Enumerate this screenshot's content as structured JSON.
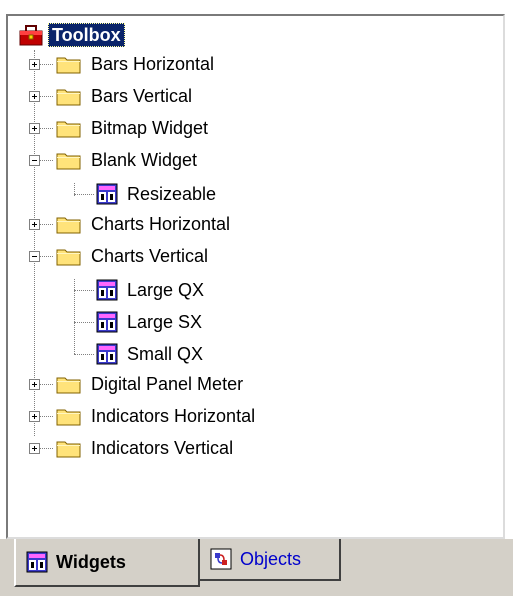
{
  "tree": {
    "root": {
      "label": "Toolbox",
      "icon": "toolbox-icon"
    },
    "items": [
      {
        "label": "Bars Horizontal",
        "type": "folder",
        "expanded": false
      },
      {
        "label": "Bars Vertical",
        "type": "folder",
        "expanded": false
      },
      {
        "label": "Bitmap Widget",
        "type": "folder",
        "expanded": false
      },
      {
        "label": "Blank Widget",
        "type": "folder",
        "expanded": true
      },
      {
        "label": "Resizeable",
        "type": "widget"
      },
      {
        "label": "Charts Horizontal",
        "type": "folder",
        "expanded": false
      },
      {
        "label": "Charts Vertical",
        "type": "folder",
        "expanded": true
      },
      {
        "label": "Large QX",
        "type": "widget"
      },
      {
        "label": "Large SX",
        "type": "widget"
      },
      {
        "label": "Small QX",
        "type": "widget"
      },
      {
        "label": "Digital Panel Meter",
        "type": "folder",
        "expanded": false
      },
      {
        "label": "Indicators Horizontal",
        "type": "folder",
        "expanded": false
      },
      {
        "label": "Indicators Vertical",
        "type": "folder",
        "expanded": false
      }
    ]
  },
  "tabs": [
    {
      "label": "Widgets",
      "active": true,
      "icon": "widgets-icon"
    },
    {
      "label": "Objects",
      "active": false,
      "icon": "objects-icon"
    }
  ],
  "colors": {
    "selection_bg": "#0a246a",
    "folder_yellow": "#ffe37a",
    "tab_bg": "#d4d0c8",
    "link_blue": "#0000cc"
  }
}
